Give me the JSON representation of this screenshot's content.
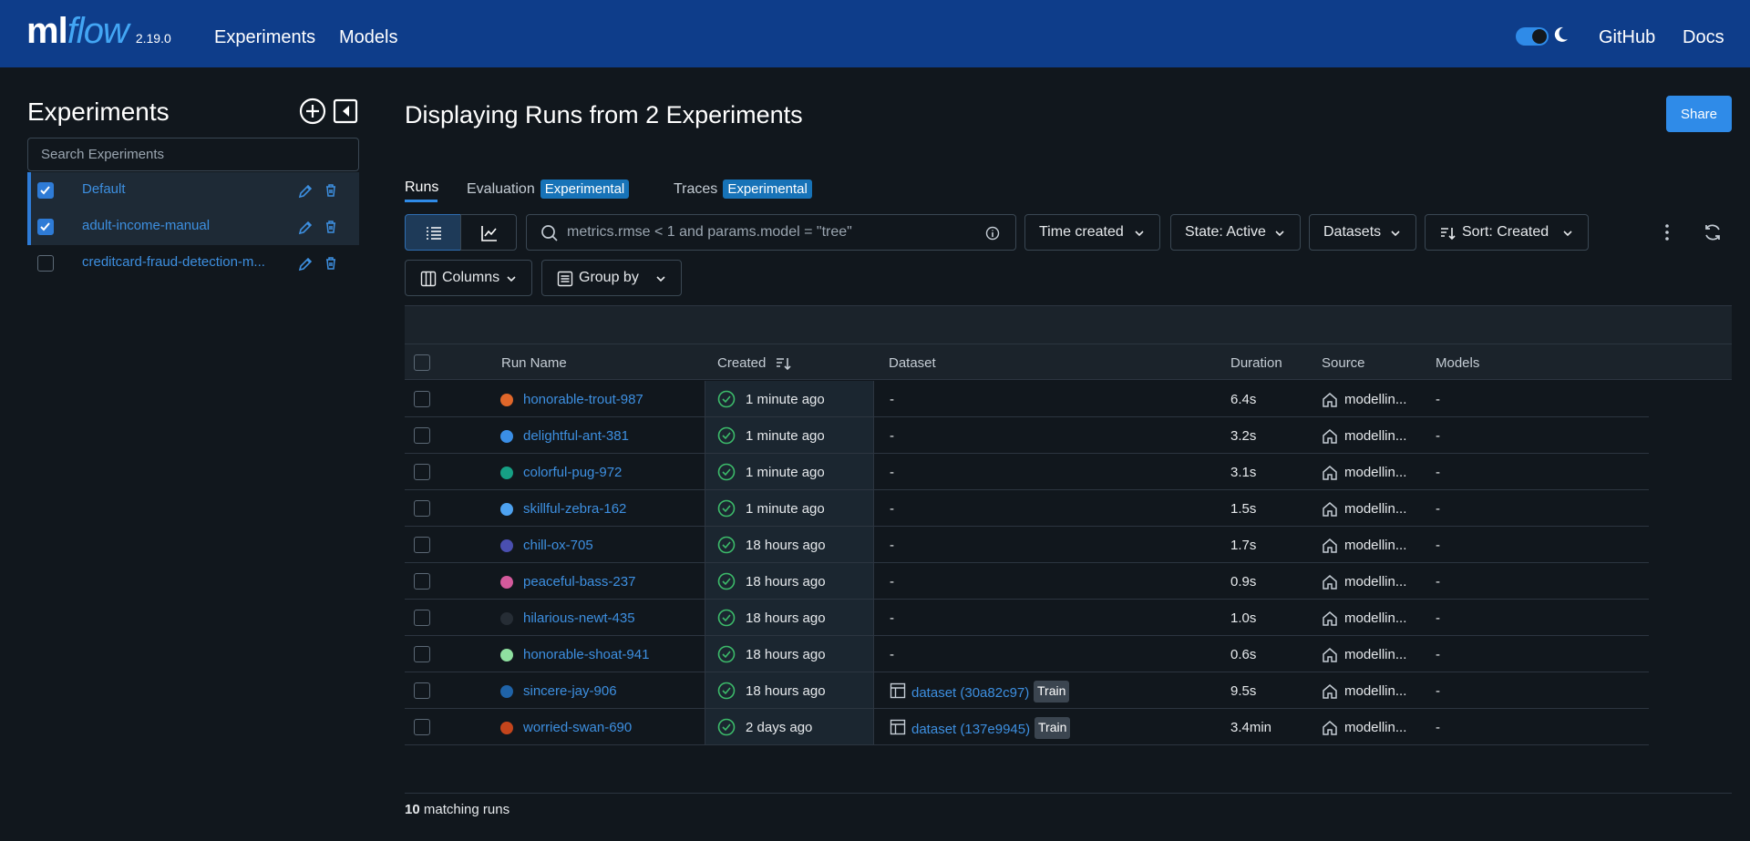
{
  "header": {
    "logo_ml": "ml",
    "logo_flow": "flow",
    "version": "2.19.0",
    "nav": [
      "Experiments",
      "Models"
    ],
    "github": "GitHub",
    "docs": "Docs"
  },
  "sidebar": {
    "title": "Experiments",
    "search_placeholder": "Search Experiments",
    "experiments": [
      {
        "name": "Default",
        "checked": true
      },
      {
        "name": "adult-income-manual",
        "checked": true
      },
      {
        "name": "creditcard-fraud-detection-m...",
        "checked": false
      }
    ]
  },
  "main": {
    "title": "Displaying Runs from 2 Experiments",
    "share": "Share",
    "tabs": [
      {
        "label": "Runs",
        "badge": ""
      },
      {
        "label": "Evaluation",
        "badge": "Experimental"
      },
      {
        "label": "Traces",
        "badge": "Experimental"
      }
    ],
    "search_placeholder": "metrics.rmse < 1 and params.model = \"tree\"",
    "filters": {
      "time_created": "Time created",
      "state": "State: Active",
      "datasets": "Datasets",
      "sort": "Sort: Created",
      "columns": "Columns",
      "group_by": "Group by"
    },
    "columns": [
      "Run Name",
      "Created",
      "Dataset",
      "Duration",
      "Source",
      "Models"
    ],
    "footer_count": "10",
    "footer_text": " matching runs"
  },
  "runs": [
    {
      "name": "honorable-trout-987",
      "color": "#e0672a",
      "created": "1 minute ago",
      "dataset": "-",
      "tag": "",
      "duration": "6.4s",
      "source": "modellin...",
      "models": "-"
    },
    {
      "name": "delightful-ant-381",
      "color": "#3a8ee6",
      "created": "1 minute ago",
      "dataset": "-",
      "tag": "",
      "duration": "3.2s",
      "source": "modellin...",
      "models": "-"
    },
    {
      "name": "colorful-pug-972",
      "color": "#16a085",
      "created": "1 minute ago",
      "dataset": "-",
      "tag": "",
      "duration": "3.1s",
      "source": "modellin...",
      "models": "-"
    },
    {
      "name": "skillful-zebra-162",
      "color": "#4ea2f0",
      "created": "1 minute ago",
      "dataset": "-",
      "tag": "",
      "duration": "1.5s",
      "source": "modellin...",
      "models": "-"
    },
    {
      "name": "chill-ox-705",
      "color": "#4a4fb0",
      "created": "18 hours ago",
      "dataset": "-",
      "tag": "",
      "duration": "1.7s",
      "source": "modellin...",
      "models": "-"
    },
    {
      "name": "peaceful-bass-237",
      "color": "#d45a9c",
      "created": "18 hours ago",
      "dataset": "-",
      "tag": "",
      "duration": "0.9s",
      "source": "modellin...",
      "models": "-"
    },
    {
      "name": "hilarious-newt-435",
      "color": "#262d35",
      "created": "18 hours ago",
      "dataset": "-",
      "tag": "",
      "duration": "1.0s",
      "source": "modellin...",
      "models": "-"
    },
    {
      "name": "honorable-shoat-941",
      "color": "#8fe0a0",
      "created": "18 hours ago",
      "dataset": "-",
      "tag": "",
      "duration": "0.6s",
      "source": "modellin...",
      "models": "-"
    },
    {
      "name": "sincere-jay-906",
      "color": "#1f63a8",
      "created": "18 hours ago",
      "dataset": "dataset (30a82c97)",
      "tag": "Train",
      "duration": "9.5s",
      "source": "modellin...",
      "models": "-"
    },
    {
      "name": "worried-swan-690",
      "color": "#c4451c",
      "created": "2 days ago",
      "dataset": "dataset (137e9945)",
      "tag": "Train",
      "duration": "3.4min",
      "source": "modellin...",
      "models": "-"
    }
  ]
}
